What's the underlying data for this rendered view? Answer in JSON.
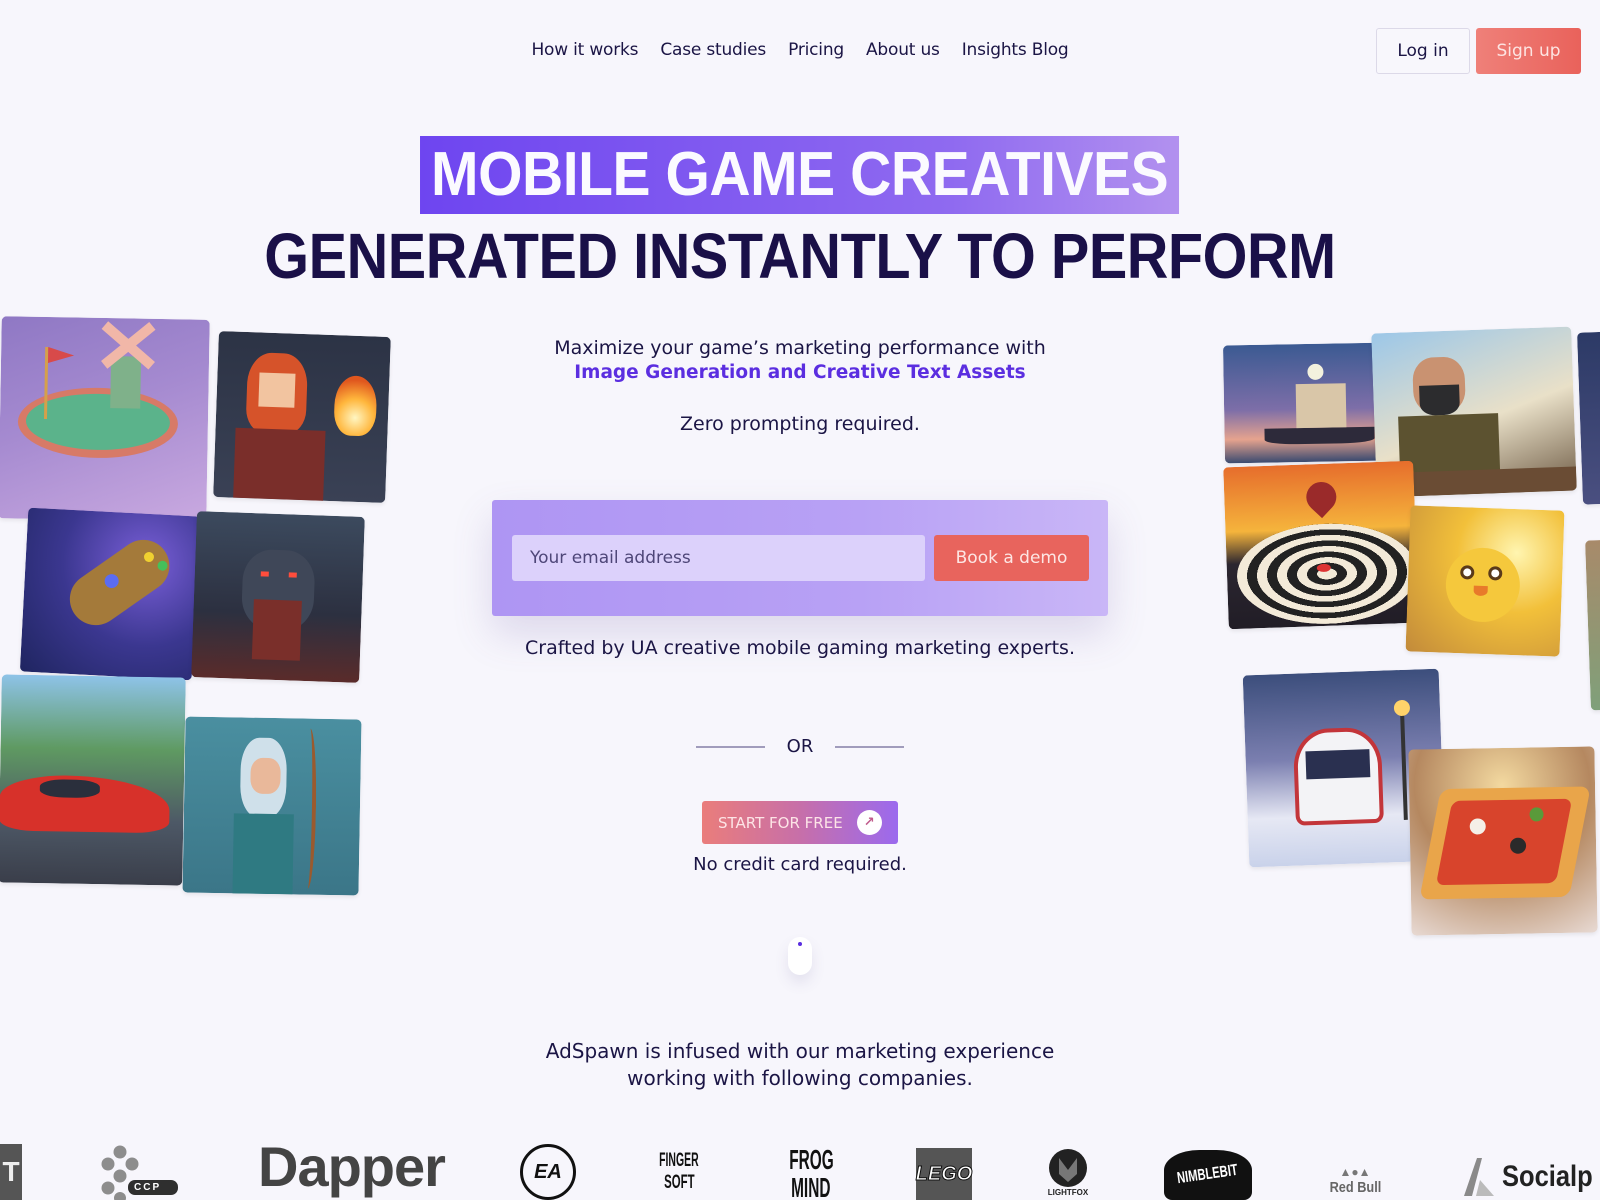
{
  "nav": {
    "links": [
      "How it works",
      "Case studies",
      "Pricing",
      "About us",
      "Insights Blog"
    ],
    "login_label": "Log in",
    "signup_label": "Sign up"
  },
  "hero": {
    "headline_highlight": "MOBILE GAME CREATIVES",
    "headline_main": "GENERATED INSTANTLY TO PERFORM",
    "subtitle_line1": "Maximize your game’s marketing performance with",
    "subtitle_emphasis": "Image Generation and Creative Text Assets",
    "subtitle_line3": "Zero prompting required."
  },
  "form": {
    "email_placeholder": "Your email address",
    "email_value": "",
    "book_demo_label": "Book a demo",
    "crafted_text": "Crafted by UA creative mobile gaming marketing experts."
  },
  "alt_cta": {
    "or_label": "OR",
    "start_label": "START FOR FREE",
    "start_icon": "arrow-up-right-icon",
    "no_cc_text": "No credit card required."
  },
  "scroll_indicator": {
    "icon": "mouse-scroll-icon"
  },
  "partners": {
    "line1": "AdSpawn is infused with our marketing experience",
    "line2": "working with following companies.",
    "logos": [
      "CCP",
      "Dapper",
      "EA",
      "Fingersoft",
      "Frogmind",
      "LEGO",
      "Lightfox",
      "Nimblebit",
      "Red Bull",
      "Socialpoint"
    ],
    "logo_texts": {
      "ccp": "CCP",
      "dapper": "Dapper",
      "ea": "EA",
      "fingersoft_1": "FINGER",
      "fingersoft_2": "SOFT",
      "frogmind_1": "FROG",
      "frogmind_2": "MIND",
      "lego": "LEGO",
      "lightfox": "LIGHTFOX",
      "nimblebit": "NIMBLEBIT",
      "redbull": "Red Bull",
      "socialpoint": "Socialp"
    }
  },
  "gallery_left": [
    {
      "subject": "mini-golf windmill"
    },
    {
      "subject": "pixel fire wizard"
    },
    {
      "subject": "infinity gauntlet"
    },
    {
      "subject": "horned demon"
    },
    {
      "subject": "red sports car"
    },
    {
      "subject": "elf archer"
    }
  ],
  "gallery_right": [
    {
      "subject": "sailing ship at night"
    },
    {
      "subject": "bearded blacksmith"
    },
    {
      "subject": "dartboard with flames"
    },
    {
      "subject": "angry yellow bird"
    },
    {
      "subject": "snowy train"
    },
    {
      "subject": "pizza slice"
    }
  ],
  "colors": {
    "background": "#f7f6fc",
    "text_dark": "#1b1545",
    "accent_purple": "#6e45f0",
    "emphasis_purple": "#5b2ee0",
    "cta_coral": "#e8645d"
  }
}
